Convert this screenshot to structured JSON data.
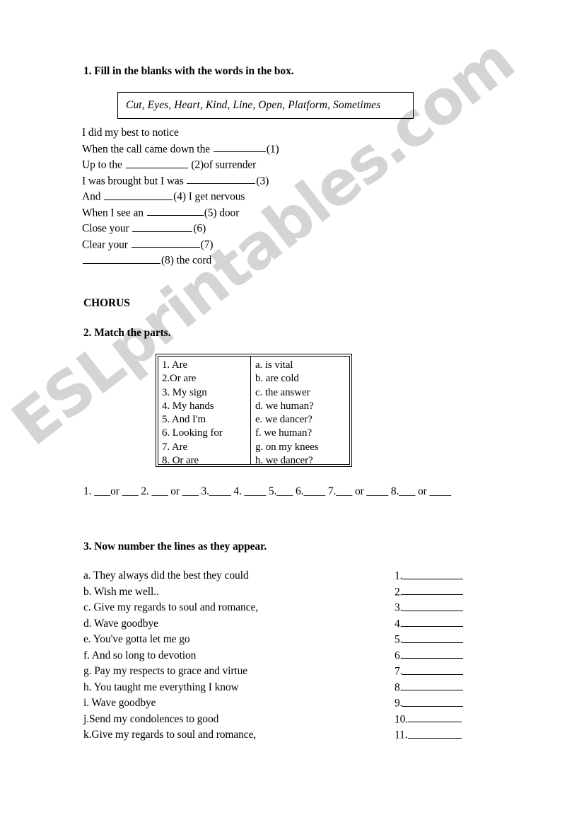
{
  "document": {
    "page_background": "#ffffff",
    "text_color": "#000000",
    "watermark": {
      "text": "ESLprintables.com",
      "color": "#d4d4d4",
      "rotation_deg": -38
    }
  },
  "exercise1": {
    "heading": "1. Fill in the blanks with the words in the box.",
    "wordbank": "Cut, Eyes, Heart, Kind, Line, Open, Platform, Sometimes",
    "wordbank_words": [
      "Cut",
      "Eyes",
      "Heart",
      "Kind",
      "Line",
      "Open",
      "Platform",
      "Sometimes"
    ],
    "lines": [
      {
        "before": "I did my best to notice",
        "blank_width": 0,
        "after": ""
      },
      {
        "before": "When the call came down the ",
        "blank_width": 74,
        "after": "(1)"
      },
      {
        "before": "Up to the ",
        "blank_width": 88,
        "after": " (2)of surrender"
      },
      {
        "before": "I was brought but I was ",
        "blank_width": 97,
        "after": "(3)"
      },
      {
        "before": "And ",
        "blank_width": 97,
        "after": "(4) I get nervous"
      },
      {
        "before": "When I see an ",
        "blank_width": 80,
        "after": "(5) door"
      },
      {
        "before": "Close your ",
        "blank_width": 85,
        "after": "(6)"
      },
      {
        "before": "Clear your ",
        "blank_width": 97,
        "after": "(7)"
      },
      {
        "before": "",
        "blank_width": 110,
        "after": "(8) the cord"
      }
    ],
    "chorus_label": "CHORUS"
  },
  "exercise2": {
    "heading": "2. Match the parts.",
    "left_column": [
      "1. Are",
      "2.Or are",
      "3. My sign",
      "4. My hands",
      "5. And I'm",
      "6. Looking for",
      "7. Are",
      "8. Or are"
    ],
    "right_column": [
      "a. is vital",
      "b. are cold",
      "c. the answer",
      "d. we human?",
      "e. we dancer?",
      "f. we human?",
      "g. on my knees",
      "h. we dancer?"
    ],
    "answer_row": "1. ___or ___ 2. ___ or ___ 3.____ 4. ____ 5.___ 6.____ 7.___ or ____ 8.___ or ____"
  },
  "exercise3": {
    "heading": "3. Now number the lines as they appear.",
    "items": [
      "a. They always did the best they could",
      "b. Wish me well..",
      "c. Give my regards to soul and romance,",
      "d. Wave goodbye",
      "e. You've gotta let me go",
      "f. And so long to devotion",
      "g. Pay my respects to grace and virtue",
      "h. You taught me everything I know",
      "i. Wave goodbye",
      "j.Send my condolences to good",
      "k.Give my regards to soul and romance,"
    ],
    "blanks": [
      "1.",
      "2.",
      "3.",
      "4.",
      "5.",
      "6.",
      "7.",
      "8.",
      "9.",
      "10.",
      "11."
    ]
  }
}
